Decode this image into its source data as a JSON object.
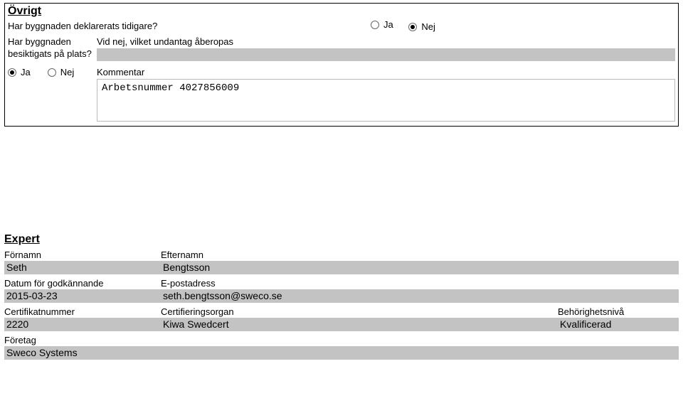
{
  "misc_section": {
    "title": "Övrigt",
    "q1": {
      "text": "Har byggnaden deklarerats tidigare?",
      "ja": "Ja",
      "nej": "Nej",
      "selected": "nej"
    },
    "q2": {
      "left": "Har byggnaden besiktigats på plats?",
      "label": "Vid nej, vilket undantag åberopas",
      "value": ""
    },
    "q3": {
      "ja": "Ja",
      "nej": "Nej",
      "selected": "ja",
      "comment_label": "Kommentar",
      "comment_value": "Arbetsnummer 4027856009"
    }
  },
  "expert_section": {
    "title": "Expert",
    "fornamn_label": "Förnamn",
    "fornamn_value": "Seth",
    "efternamn_label": "Efternamn",
    "efternamn_value": "Bengtsson",
    "datum_label": "Datum för godkännande",
    "datum_value": "2015-03-23",
    "epost_label": "E-postadress",
    "epost_value": "seth.bengtsson@sweco.se",
    "cert_label": "Certifikatnummer",
    "cert_value": "2220",
    "organ_label": "Certifieringsorgan",
    "organ_value": "Kiwa Swedcert",
    "niva_label": "Behörighetsnivå",
    "niva_value": "Kvalificerad",
    "foretag_label": "Företag",
    "foretag_value": "Sweco Systems"
  }
}
